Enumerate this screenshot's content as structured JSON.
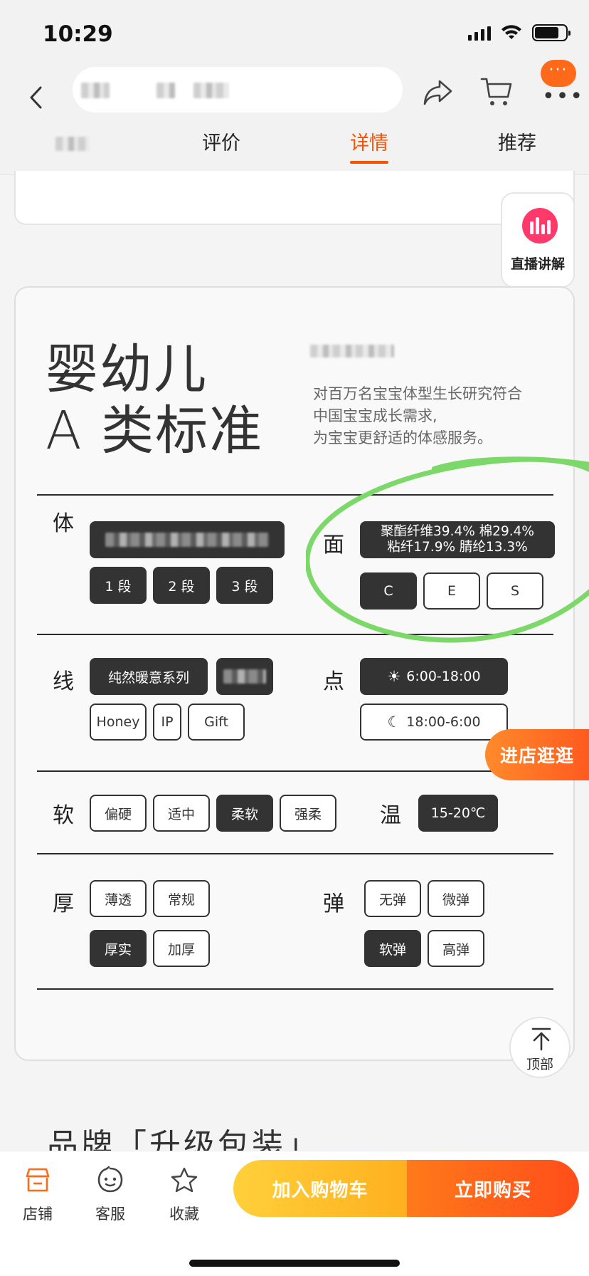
{
  "status_bar": {
    "time": "10:29"
  },
  "nav": {
    "back_icon": "chevron-left-icon",
    "share_icon": "share-icon",
    "cart_icon": "cart-icon",
    "more_badge": "···",
    "more_dots": "•••"
  },
  "tabs": [
    {
      "label": "评价"
    },
    {
      "label": "详情",
      "active": true
    },
    {
      "label": "推荐"
    }
  ],
  "live": {
    "label": "直播讲解"
  },
  "spec": {
    "title_line1": "婴幼儿",
    "title_line2": "A 类标准",
    "description_lines": [
      "对百万名宝宝体型生长研究符合",
      "中国宝宝成长需求,",
      "为宝宝更舒适的体感服务。"
    ],
    "body": {
      "label": "体",
      "stages": [
        "1 段",
        "2 段",
        "3 段"
      ]
    },
    "fabric": {
      "label": "面",
      "composition_line1": "聚酯纤维39.4% 棉29.4%",
      "composition_line2": "粘纤17.9% 腈纶13.3%",
      "options": [
        "C",
        "E",
        "S"
      ]
    },
    "line": {
      "label": "线",
      "series": "纯然暖意系列",
      "options": [
        "Honey",
        "IP",
        "Gift"
      ]
    },
    "time": {
      "label": "点",
      "day": "6:00-18:00",
      "night": "18:00-6:00"
    },
    "softness": {
      "label": "软",
      "options": [
        "偏硬",
        "适中",
        "柔软",
        "强柔"
      ],
      "selected": "柔软"
    },
    "temperature": {
      "label": "温",
      "value": "15-20℃"
    },
    "thickness": {
      "label": "厚",
      "options": [
        "薄透",
        "常规",
        "厚实",
        "加厚"
      ],
      "selected": "厚实"
    },
    "elasticity": {
      "label": "弹",
      "options": [
        "无弹",
        "微弹",
        "软弹",
        "高弹"
      ],
      "selected": "软弹"
    }
  },
  "floating": {
    "shop": "进店逛逛",
    "top": "顶部"
  },
  "brand_heading": "品牌「升级包装」",
  "bottom_bar": {
    "store": "店铺",
    "service": "客服",
    "favorite": "收藏",
    "add_to_cart": "加入购物车",
    "buy_now": "立即购买"
  },
  "colors": {
    "accent": "#ff5000",
    "annotation_green": "#7dd86a",
    "chip_dark": "#333333"
  }
}
